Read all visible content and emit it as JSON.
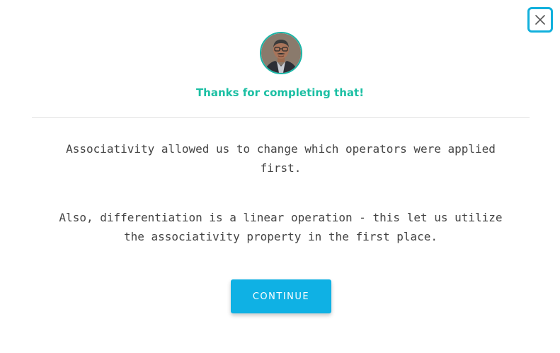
{
  "dialog": {
    "close_icon": "close-icon",
    "avatar_icon": "instructor-avatar",
    "headline": "Thanks for completing that!",
    "paragraphs": [
      "Associativity allowed us to change which operators were applied first.",
      "Also, differentiation is a linear operation - this let us utilize the associativity property in the first place."
    ],
    "continue_label": "CONTINUE"
  },
  "colors": {
    "accent_teal": "#1bbfa3",
    "button_blue": "#0fb1e4",
    "close_border": "#11b0dc",
    "text": "#444444",
    "divider": "#e2e2e2"
  }
}
